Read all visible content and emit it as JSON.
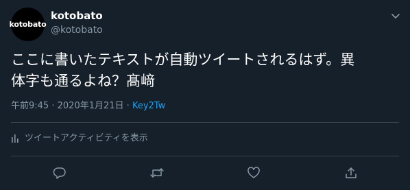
{
  "tweet": {
    "avatar_text": "kotobato",
    "display_name": "kotobato",
    "handle": "@kotobato",
    "text_line1": "ここに書いたテキストが自動ツイートされるはず。異",
    "text_line2": "体字も通るよね？髙﨑",
    "time": "午前9:45",
    "separator": "·",
    "date": "2020年1月21日",
    "source": "Key2Tw",
    "activity_label": "ツイートアクティビティを表示"
  },
  "colors": {
    "background": "#15202b",
    "text_primary": "#ffffff",
    "text_secondary": "#8899a6",
    "link": "#1da1f2",
    "divider": "#38444d"
  },
  "icons": {
    "menu": "chevron-down-icon",
    "activity": "bar-chart-icon",
    "reply": "reply-icon",
    "retweet": "retweet-icon",
    "like": "heart-icon",
    "share": "share-icon"
  }
}
